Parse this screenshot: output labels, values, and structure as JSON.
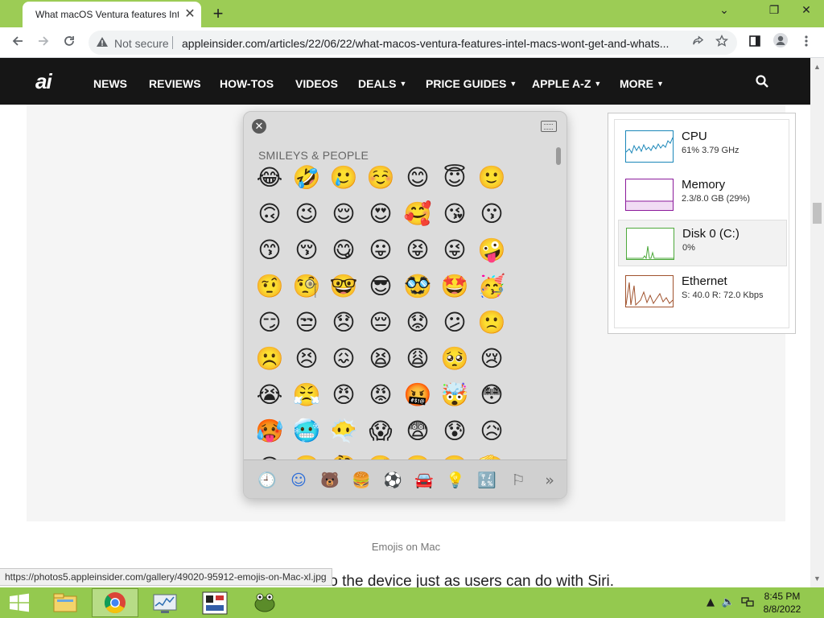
{
  "browser": {
    "tab_title": "What macOS Ventura features Intel Macs won't get and what's new",
    "tab_close": "✕",
    "new_tab": "+",
    "window_controls": {
      "minimize": "⌄",
      "restore": "❐",
      "close": "✕"
    },
    "security_label": "Not secure",
    "url": "appleinsider.com/articles/22/06/22/what-macos-ventura-features-intel-macs-wont-get-and-whats..."
  },
  "site": {
    "logo": "ai",
    "nav": [
      {
        "label": "NEWS"
      },
      {
        "label": "REVIEWS"
      },
      {
        "label": "HOW-TOS"
      },
      {
        "label": "VIDEOS"
      },
      {
        "label": "DEALS"
      },
      {
        "label": "PRICE GUIDES"
      },
      {
        "label": "APPLE A-Z"
      },
      {
        "label": "MORE"
      }
    ],
    "caret": "▼"
  },
  "picker": {
    "close": "✕",
    "heading": "SMILEYS & PEOPLE",
    "emojis": [
      [
        "😂",
        "🤣",
        "🥲",
        "☺️",
        "😊",
        "😇",
        "🙂"
      ],
      [
        "🙃",
        "😉",
        "😌",
        "😍",
        "🥰",
        "😘",
        "😗"
      ],
      [
        "😙",
        "😚",
        "😋",
        "😛",
        "😝",
        "😜",
        "🤪"
      ],
      [
        "🤨",
        "🧐",
        "🤓",
        "😎",
        "🥸",
        "🤩",
        "🥳"
      ],
      [
        "😏",
        "😒",
        "😞",
        "😔",
        "😟",
        "😕",
        "🙁"
      ],
      [
        "☹️",
        "😣",
        "😖",
        "😫",
        "😩",
        "🥺",
        "😢"
      ],
      [
        "😭",
        "😤",
        "😠",
        "😡",
        "🤬",
        "🤯",
        "😳"
      ],
      [
        "🥵",
        "🥶",
        "😶‍🌫️",
        "😱",
        "😨",
        "😰",
        "😥"
      ],
      [
        "😓",
        "🤗",
        "🤔",
        "🫣",
        "🤭",
        "🫢",
        "🫡"
      ]
    ],
    "categories": [
      {
        "icon": "🕘",
        "name": "recent"
      },
      {
        "icon": "☺",
        "name": "smileys"
      },
      {
        "icon": "🐻",
        "name": "animals"
      },
      {
        "icon": "🍔",
        "name": "food"
      },
      {
        "icon": "⚽",
        "name": "activity"
      },
      {
        "icon": "🚘",
        "name": "travel"
      },
      {
        "icon": "💡",
        "name": "objects"
      },
      {
        "icon": "🔣",
        "name": "symbols"
      },
      {
        "icon": "⚐",
        "name": "flags"
      },
      {
        "icon": "»",
        "name": "more"
      }
    ],
    "active_category": "smileys"
  },
  "taskmgr": {
    "rows": [
      {
        "name": "CPU",
        "value": "61%  3.79 GHz",
        "color": "#1b87b9"
      },
      {
        "name": "Memory",
        "value": "2.3/8.0 GB (29%)",
        "color": "#8b1a9b"
      },
      {
        "name": "Disk 0 (C:)",
        "value": "0%",
        "color": "#4da93b"
      },
      {
        "name": "Ethernet",
        "value": "S: 40.0  R: 72.0 Kbps",
        "color": "#a0522d"
      }
    ]
  },
  "article": {
    "caption": "Emojis on Mac",
    "paragraph_fragment": "to the device just as users can do with Siri."
  },
  "status_url": "https://photos5.appleinsider.com/gallery/49020-95912-emojis-on-Mac-xl.jpg",
  "taskbar": {
    "time": "8:45 PM",
    "date": "8/8/2022"
  },
  "colors": {
    "chrome_frame": "#9ccc55",
    "taskbar": "#94c94f",
    "site_nav": "#161616"
  }
}
